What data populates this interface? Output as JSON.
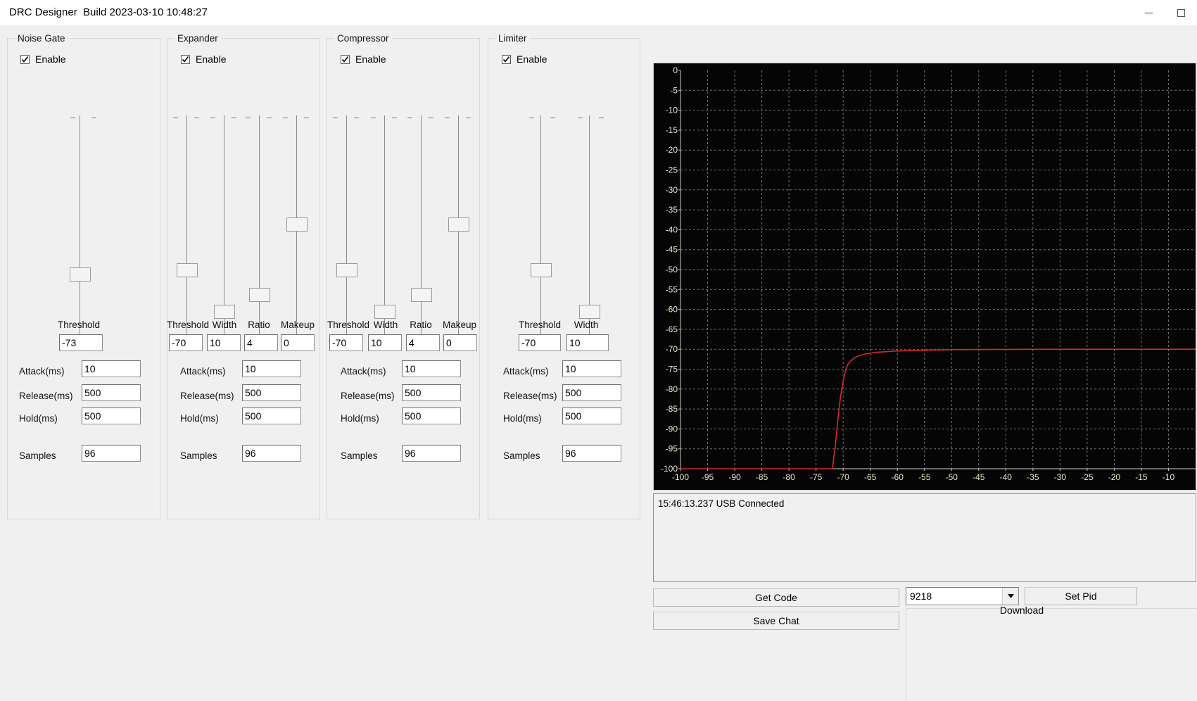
{
  "window": {
    "title": "DRC Designer  Build 2023-03-10 10:48:27",
    "minimize_icon": "minimize-icon",
    "maximize_icon": "maximize-icon"
  },
  "panels": [
    {
      "id": "noise-gate",
      "title": "Noise Gate",
      "enable_label": "Enable",
      "enabled": true,
      "sliders": [
        {
          "name": "threshold",
          "label": "Threshold",
          "value": "-73",
          "pos": 0.72
        }
      ],
      "fields": [
        {
          "name": "attack",
          "label": "Attack(ms)",
          "value": "10"
        },
        {
          "name": "release",
          "label": "Release(ms)",
          "value": "500"
        },
        {
          "name": "hold",
          "label": "Hold(ms)",
          "value": "500"
        },
        {
          "name": "samples",
          "label": "Samples",
          "value": "96"
        }
      ]
    },
    {
      "id": "expander",
      "title": "Expander",
      "enable_label": "Enable",
      "enabled": true,
      "sliders": [
        {
          "name": "threshold",
          "label": "Threshold",
          "value": "-70",
          "pos": 0.7
        },
        {
          "name": "width",
          "label": "Width",
          "value": "10",
          "pos": 0.9
        },
        {
          "name": "ratio",
          "label": "Ratio",
          "value": "4",
          "pos": 0.83
        },
        {
          "name": "makeup",
          "label": "Makeup",
          "value": "0",
          "pos": 0.5
        }
      ],
      "fields": [
        {
          "name": "attack",
          "label": "Attack(ms)",
          "value": "10"
        },
        {
          "name": "release",
          "label": "Release(ms)",
          "value": "500"
        },
        {
          "name": "hold",
          "label": "Hold(ms)",
          "value": "500"
        },
        {
          "name": "samples",
          "label": "Samples",
          "value": "96"
        }
      ]
    },
    {
      "id": "compressor",
      "title": "Compressor",
      "enable_label": "Enable",
      "enabled": true,
      "sliders": [
        {
          "name": "threshold",
          "label": "Threshold",
          "value": "-70",
          "pos": 0.7
        },
        {
          "name": "width",
          "label": "Width",
          "value": "10",
          "pos": 0.9
        },
        {
          "name": "ratio",
          "label": "Ratio",
          "value": "4",
          "pos": 0.83
        },
        {
          "name": "makeup",
          "label": "Makeup",
          "value": "0",
          "pos": 0.5
        }
      ],
      "fields": [
        {
          "name": "attack",
          "label": "Attack(ms)",
          "value": "10"
        },
        {
          "name": "release",
          "label": "Release(ms)",
          "value": "500"
        },
        {
          "name": "hold",
          "label": "Hold(ms)",
          "value": "500"
        },
        {
          "name": "samples",
          "label": "Samples",
          "value": "96"
        }
      ]
    },
    {
      "id": "limiter",
      "title": "Limiter",
      "enable_label": "Enable",
      "enabled": true,
      "sliders": [
        {
          "name": "threshold",
          "label": "Threshold",
          "value": "-70",
          "pos": 0.7
        },
        {
          "name": "width",
          "label": "Width",
          "value": "10",
          "pos": 0.9
        }
      ],
      "fields": [
        {
          "name": "attack",
          "label": "Attack(ms)",
          "value": "10"
        },
        {
          "name": "release",
          "label": "Release(ms)",
          "value": "500"
        },
        {
          "name": "hold",
          "label": "Hold(ms)",
          "value": "500"
        },
        {
          "name": "samples",
          "label": "Samples",
          "value": "96"
        }
      ]
    }
  ],
  "log": {
    "lines": [
      "15:46:13.237 USB Connected"
    ]
  },
  "controls": {
    "get_code_label": "Get Code",
    "save_chat_label": "Save Chat",
    "set_pid_label": "Set Pid",
    "download_label": "Download",
    "pid_value": "9218",
    "pid_options": [
      "9218"
    ]
  },
  "chart_data": {
    "type": "line",
    "title": "",
    "xlabel": "",
    "ylabel": "",
    "xlim": [
      -100,
      -5
    ],
    "ylim": [
      -100,
      0
    ],
    "xticks": [
      -100,
      -95,
      -90,
      -85,
      -80,
      -75,
      -70,
      -65,
      -60,
      -55,
      -50,
      -45,
      -40,
      -35,
      -30,
      -25,
      -20,
      -15,
      -10
    ],
    "yticks": [
      0,
      -5,
      -10,
      -15,
      -20,
      -25,
      -30,
      -35,
      -40,
      -45,
      -50,
      -55,
      -60,
      -65,
      -70,
      -75,
      -80,
      -85,
      -90,
      -95,
      -100
    ],
    "grid": true,
    "legend": "none",
    "background": "#050505",
    "grid_color": "#9a9a9a",
    "axis_color": "#cccccc",
    "tick_label_color": "#f0e6c8",
    "series": [
      {
        "name": "transfer-curve",
        "color": "#d42a2a",
        "x": [
          -100,
          -72,
          -71.5,
          -71,
          -70.5,
          -70,
          -69.5,
          -69,
          -68,
          -67,
          -66,
          -64,
          -61,
          -57,
          -50,
          -40,
          -30,
          -20,
          -5
        ],
        "y": [
          -100,
          -100,
          -95,
          -88,
          -82,
          -78,
          -75,
          -73.5,
          -72.2,
          -71.6,
          -71.2,
          -70.8,
          -70.5,
          -70.3,
          -70.1,
          -70.05,
          -70,
          -70,
          -70
        ]
      }
    ]
  }
}
